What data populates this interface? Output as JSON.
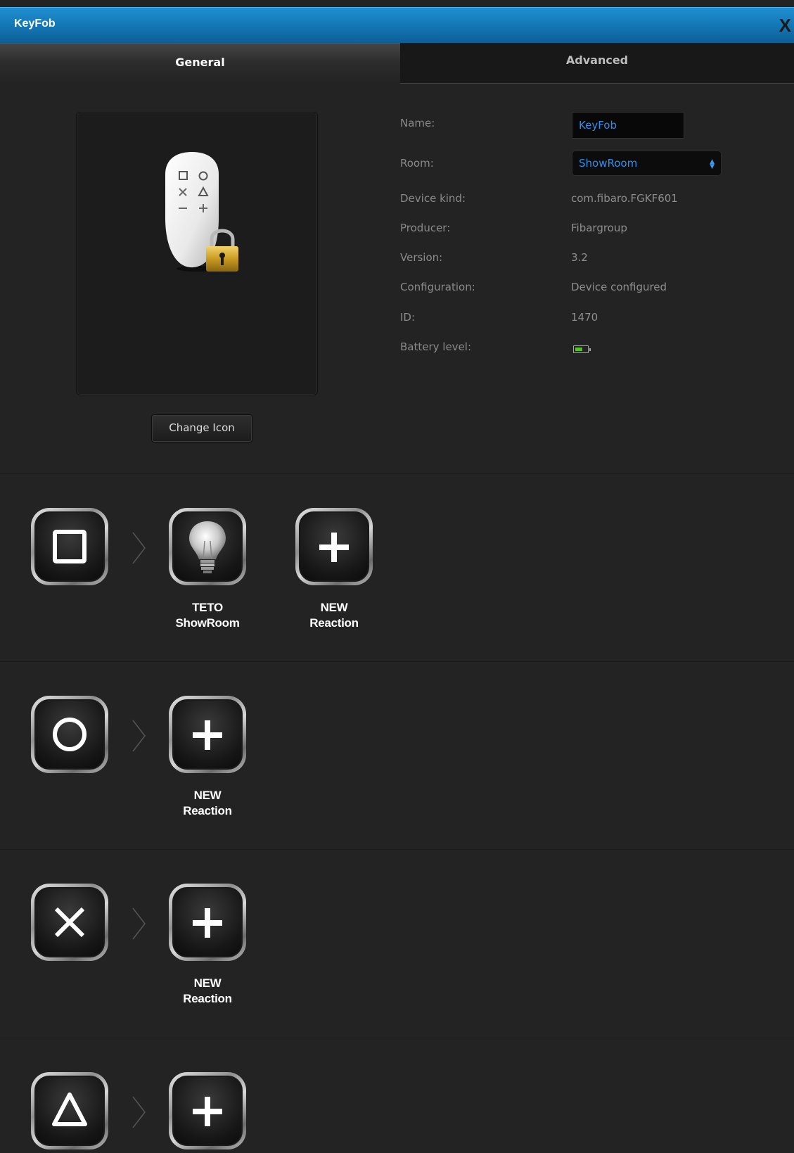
{
  "window": {
    "title": "KeyFob",
    "close_label": "X"
  },
  "tabs": {
    "general": "General",
    "advanced": "Advanced"
  },
  "icon_panel": {
    "change_icon_label": "Change Icon"
  },
  "properties": {
    "name_label": "Name:",
    "name_value": "KeyFob",
    "room_label": "Room:",
    "room_value": "ShowRoom",
    "device_kind_label": "Device kind:",
    "device_kind_value": "com.fibaro.FGKF601",
    "producer_label": "Producer:",
    "producer_value": "Fibargroup",
    "version_label": "Version:",
    "version_value": "3.2",
    "configuration_label": "Configuration:",
    "configuration_value": "Device configured",
    "id_label": "ID:",
    "id_value": "1470",
    "battery_label": "Battery level:"
  },
  "scenes": [
    {
      "trigger_icon": "square-icon",
      "reactions": [
        {
          "icon": "lightbulb-icon",
          "line1": "TETO",
          "line2": "ShowRoom"
        },
        {
          "icon": "plus-icon",
          "line1": "NEW",
          "line2": "Reaction"
        }
      ]
    },
    {
      "trigger_icon": "circle-icon",
      "reactions": [
        {
          "icon": "plus-icon",
          "line1": "NEW",
          "line2": "Reaction"
        }
      ]
    },
    {
      "trigger_icon": "cross-icon",
      "reactions": [
        {
          "icon": "plus-icon",
          "line1": "NEW",
          "line2": "Reaction"
        }
      ]
    },
    {
      "trigger_icon": "triangle-icon",
      "reactions": [
        {
          "icon": "plus-icon"
        }
      ]
    }
  ],
  "colors": {
    "titlebar": "#1478b6",
    "accent_text": "#2a8ff0",
    "battery_fill": "#5bbf27",
    "background": "#232323"
  }
}
